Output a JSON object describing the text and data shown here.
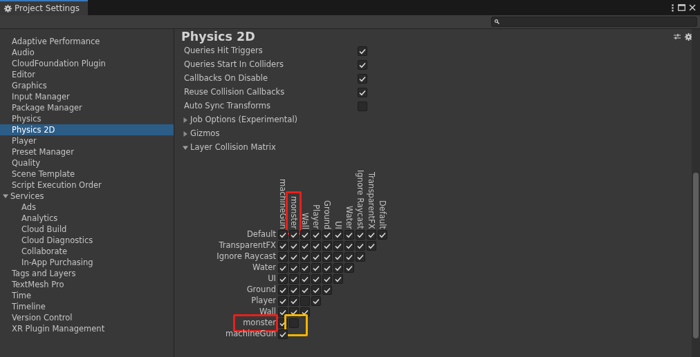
{
  "window": {
    "tab_title": "Project Settings"
  },
  "sidebar": {
    "items": [
      {
        "label": "Adaptive Performance",
        "selected": false
      },
      {
        "label": "Audio",
        "selected": false
      },
      {
        "label": "CloudFoundation Plugin",
        "selected": false
      },
      {
        "label": "Editor",
        "selected": false
      },
      {
        "label": "Graphics",
        "selected": false
      },
      {
        "label": "Input Manager",
        "selected": false
      },
      {
        "label": "Package Manager",
        "selected": false
      },
      {
        "label": "Physics",
        "selected": false
      },
      {
        "label": "Physics 2D",
        "selected": true
      },
      {
        "label": "Player",
        "selected": false
      },
      {
        "label": "Preset Manager",
        "selected": false
      },
      {
        "label": "Quality",
        "selected": false
      },
      {
        "label": "Scene Template",
        "selected": false
      },
      {
        "label": "Script Execution Order",
        "selected": false
      },
      {
        "label": "Services",
        "selected": false,
        "expanded": true,
        "children": [
          {
            "label": "Ads",
            "selected": false
          },
          {
            "label": "Analytics",
            "selected": false
          },
          {
            "label": "Cloud Build",
            "selected": false
          },
          {
            "label": "Cloud Diagnostics",
            "selected": false
          },
          {
            "label": "Collaborate",
            "selected": false
          },
          {
            "label": "In-App Purchasing",
            "selected": false
          }
        ]
      },
      {
        "label": "Tags and Layers",
        "selected": false
      },
      {
        "label": "TextMesh Pro",
        "selected": false
      },
      {
        "label": "Time",
        "selected": false
      },
      {
        "label": "Timeline",
        "selected": false
      },
      {
        "label": "Version Control",
        "selected": false
      },
      {
        "label": "XR Plugin Management",
        "selected": false
      }
    ]
  },
  "page": {
    "title": "Physics 2D",
    "settings": [
      {
        "kind": "toggle",
        "label": "Queries Hit Triggers",
        "checked": true
      },
      {
        "kind": "toggle",
        "label": "Queries Start In Colliders",
        "checked": true
      },
      {
        "kind": "toggle",
        "label": "Callbacks On Disable",
        "checked": true
      },
      {
        "kind": "toggle",
        "label": "Reuse Collision Callbacks",
        "checked": true
      },
      {
        "kind": "toggle",
        "label": "Auto Sync Transforms",
        "checked": false
      },
      {
        "kind": "foldout",
        "label": "Job Options (Experimental)",
        "expanded": false
      },
      {
        "kind": "foldout",
        "label": "Gizmos",
        "expanded": false
      },
      {
        "kind": "foldout",
        "label": "Layer Collision Matrix",
        "expanded": true
      }
    ],
    "matrix": {
      "columns": [
        {
          "label": "machineGun"
        },
        {
          "label": "monster",
          "annotated": true
        },
        {
          "label": "Wall"
        },
        {
          "label": "Player"
        },
        {
          "label": "Ground"
        },
        {
          "label": "UI"
        },
        {
          "label": "Water"
        },
        {
          "label": "Ignore Raycast"
        },
        {
          "label": "TransparentFX"
        },
        {
          "label": "Default"
        }
      ],
      "rows": [
        {
          "label": "Default",
          "cells": [
            true,
            true,
            true,
            true,
            true,
            true,
            true,
            true,
            true,
            true
          ]
        },
        {
          "label": "TransparentFX",
          "cells": [
            true,
            true,
            true,
            true,
            true,
            true,
            true,
            true,
            true
          ]
        },
        {
          "label": "Ignore Raycast",
          "cells": [
            true,
            true,
            true,
            true,
            true,
            true,
            true,
            true
          ]
        },
        {
          "label": "Water",
          "cells": [
            true,
            true,
            true,
            true,
            true,
            true,
            true
          ]
        },
        {
          "label": "UI",
          "cells": [
            true,
            true,
            true,
            true,
            true,
            true
          ]
        },
        {
          "label": "Ground",
          "cells": [
            true,
            true,
            true,
            true,
            true
          ]
        },
        {
          "label": "Player",
          "cells": [
            true,
            true,
            false,
            true
          ]
        },
        {
          "label": "Wall",
          "cells": [
            true,
            true,
            true
          ]
        },
        {
          "label": "monster",
          "annotated": true,
          "cells": [
            true,
            false
          ],
          "annotated_cells": [
            false,
            true
          ]
        },
        {
          "label": "machineGun",
          "cells": [
            true
          ]
        }
      ]
    }
  }
}
